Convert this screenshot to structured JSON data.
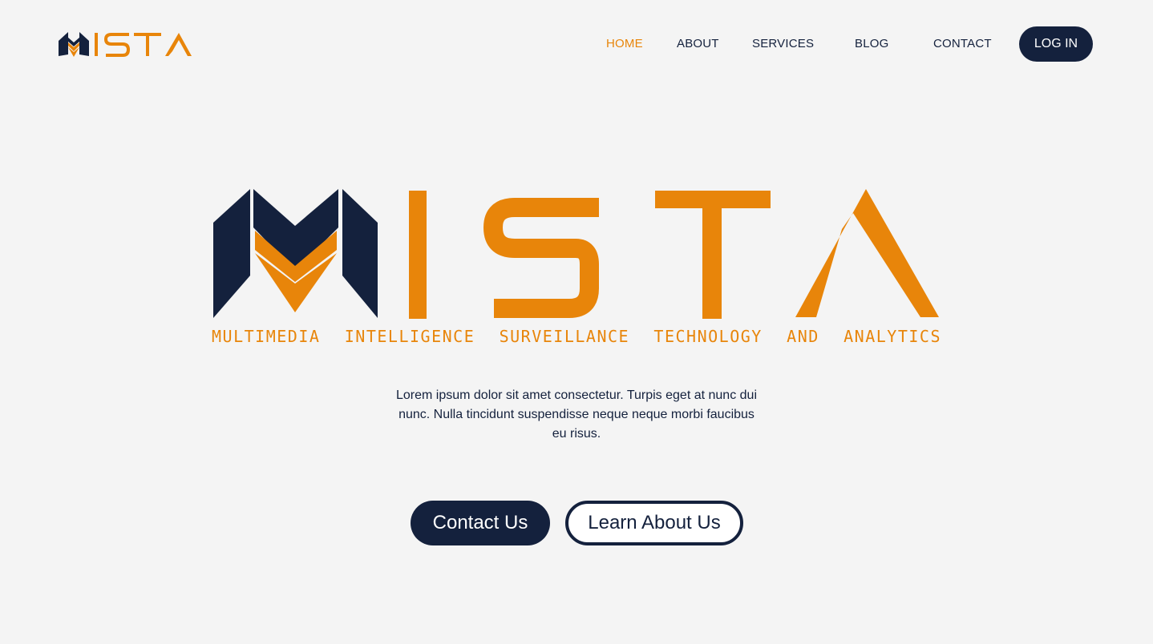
{
  "brand": {
    "name": "MISTA",
    "tagline": "MULTIMEDIA INTELLIGENCE SURVEILLANCE TECHNOLOGY AND ANALYTICS",
    "colors": {
      "navy": "#14213d",
      "orange": "#e8850a",
      "background": "#f4f4f4"
    }
  },
  "nav": {
    "items": [
      {
        "label": "HOME",
        "active": true
      },
      {
        "label": "ABOUT"
      },
      {
        "label": "SERVICES"
      },
      {
        "label": "BLOG"
      },
      {
        "label": "CONTACT"
      }
    ],
    "login_label": "LOG IN"
  },
  "hero": {
    "description": "Lorem ipsum dolor sit amet consectetur. Turpis eget at nunc dui nunc. Nulla tincidunt suspendisse neque neque morbi faucibus eu risus.",
    "primary_button": "Contact Us",
    "secondary_button": "Learn About Us"
  },
  "icons": {
    "logo": "mista-logo-icon"
  }
}
